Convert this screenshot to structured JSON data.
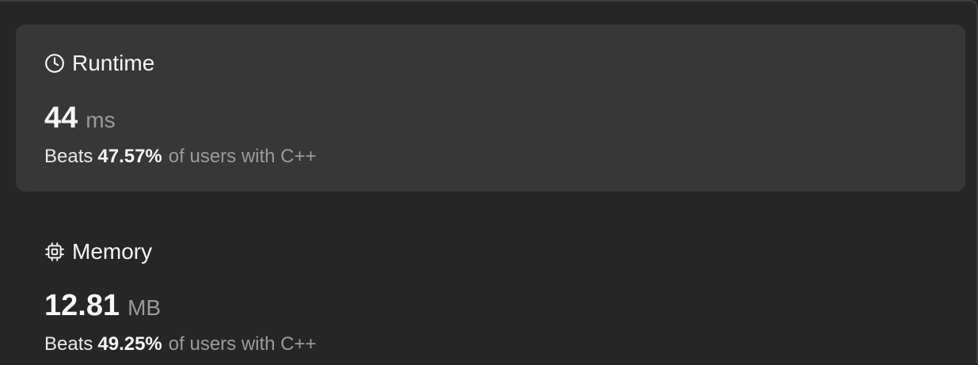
{
  "runtime": {
    "title": "Runtime",
    "icon": "clock-icon",
    "value": "44",
    "unit": "ms",
    "beats_prefix": "Beats",
    "beats_percent": "47.57%",
    "beats_suffix": "of users with C++"
  },
  "memory": {
    "title": "Memory",
    "icon": "chip-icon",
    "value": "12.81",
    "unit": "MB",
    "beats_prefix": "Beats",
    "beats_percent": "49.25%",
    "beats_suffix": "of users with C++"
  },
  "colors": {
    "background": "#262626",
    "active_card": "#373737",
    "primary_text": "#f5f5f5",
    "secondary_text": "#9a9a9a"
  }
}
